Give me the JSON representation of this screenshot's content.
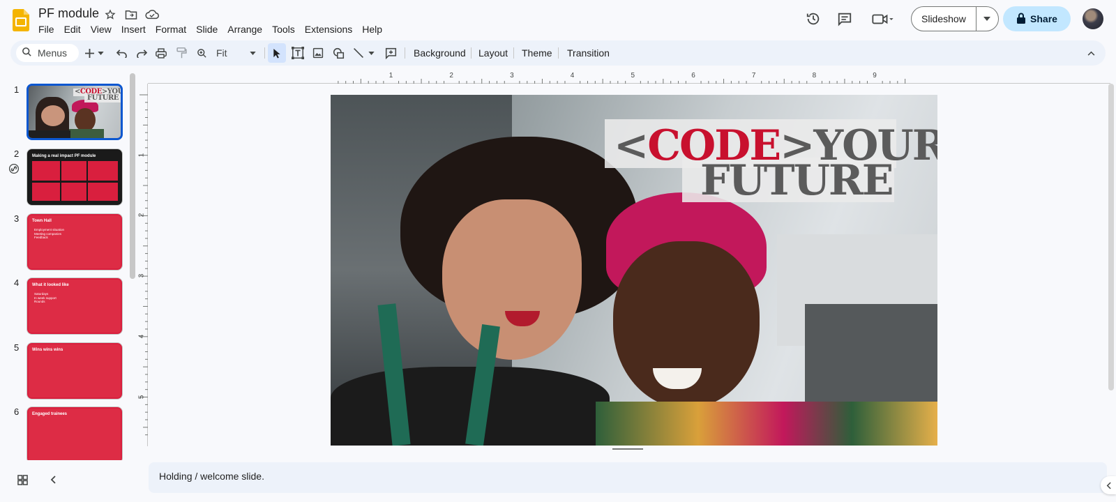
{
  "app": {
    "doc_title": "PF module",
    "menus": [
      "File",
      "Edit",
      "View",
      "Insert",
      "Format",
      "Slide",
      "Arrange",
      "Tools",
      "Extensions",
      "Help"
    ]
  },
  "header": {
    "slideshow_label": "Slideshow",
    "share_label": "Share"
  },
  "toolbar": {
    "search_placeholder": "Menus",
    "zoom_value": "Fit",
    "background_label": "Background",
    "layout_label": "Layout",
    "theme_label": "Theme",
    "transition_label": "Transition"
  },
  "rulers": {
    "horizontal": [
      "1",
      "2",
      "3",
      "4",
      "5",
      "6",
      "7",
      "8",
      "9"
    ],
    "vertical": [
      "1",
      "2",
      "3",
      "4",
      "5"
    ]
  },
  "slides": [
    {
      "number": "1",
      "title": "",
      "bullets": []
    },
    {
      "number": "2",
      "title": "Making a real impact PF module",
      "bullets": []
    },
    {
      "number": "3",
      "title": "Town Hall",
      "bullets": [
        "Employment situation",
        "Meeting companies",
        "Feedback"
      ]
    },
    {
      "number": "4",
      "title": "What it looked like",
      "bullets": [
        "Saturdays",
        "In week support",
        "Rounds"
      ]
    },
    {
      "number": "5",
      "title": "Wins wins wins",
      "bullets": []
    },
    {
      "number": "6",
      "title": "Engaged trainees",
      "bullets": []
    }
  ],
  "current_slide": {
    "title_prefix": "<",
    "title_code": "CODE",
    "title_suffix": ">YOUR",
    "title_line2": "FUTURE"
  },
  "thumbnail_title": {
    "line1_prefix": "<",
    "line1_code": "CODE",
    "line1_suffix": ">YOUR",
    "line2": "FUTURE"
  },
  "notes": {
    "text": "Holding / welcome slide."
  },
  "colors": {
    "brand_red": "#c8102e",
    "accent_blue": "#0b57d0",
    "share_bg": "#c2e7ff",
    "toolbar_bg": "#edf2fa"
  }
}
